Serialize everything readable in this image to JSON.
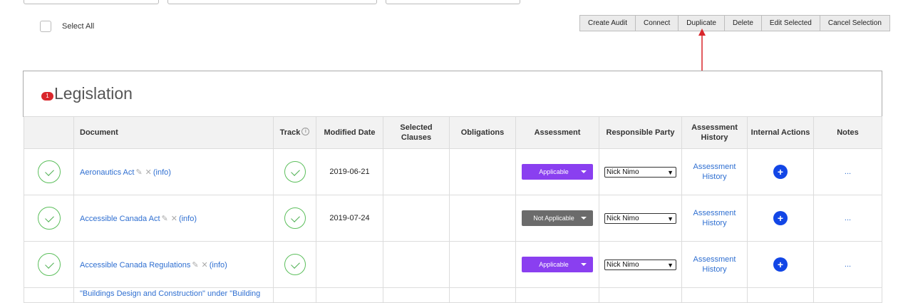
{
  "select_all": {
    "label": "Select All"
  },
  "toolbar": {
    "buttons": [
      "Create Audit",
      "Connect",
      "Duplicate",
      "Delete",
      "Edit Selected",
      "Cancel Selection"
    ]
  },
  "annotation": {
    "color": "#d9262b"
  },
  "section": {
    "badge_count": "1",
    "title": "Legislation"
  },
  "table": {
    "headers": {
      "document": "Document",
      "track": "Track",
      "modified_date": "Modified Date",
      "selected_clauses": "Selected Clauses",
      "obligations": "Obligations",
      "assessment": "Assessment",
      "responsible_party": "Responsible Party",
      "assessment_history": "Assessment History",
      "internal_actions": "Internal Actions",
      "notes": "Notes"
    },
    "info_glyph": "i",
    "rows": [
      {
        "document": "Aeronautics Act",
        "edit_glyph": "✎",
        "remove_glyph": "✕",
        "info": "(info)",
        "modified_date": "2019-06-21",
        "assessment": "Applicable",
        "assessment_color": "#8a3ff0",
        "responsible_party": "Nick Nimo",
        "history": "Assessment History",
        "action": "+",
        "notes": "..."
      },
      {
        "document": "Accessible Canada Act",
        "edit_glyph": "✎",
        "remove_glyph": "✕",
        "info": "(info)",
        "modified_date": "2019-07-24",
        "assessment": "Not Applicable",
        "assessment_color": "#6b6b6b",
        "responsible_party": "Nick Nimo",
        "history": "Assessment History",
        "action": "+",
        "notes": "..."
      },
      {
        "document": "Accessible Canada Regulations",
        "edit_glyph": "✎",
        "remove_glyph": "✕",
        "info": "(info)",
        "modified_date": "",
        "assessment": "Applicable",
        "assessment_color": "#8a3ff0",
        "responsible_party": "Nick Nimo",
        "history": "Assessment History",
        "action": "+",
        "notes": "..."
      }
    ],
    "partial_row": {
      "document": "\"Buildings Design and Construction\" under \"Building"
    }
  }
}
